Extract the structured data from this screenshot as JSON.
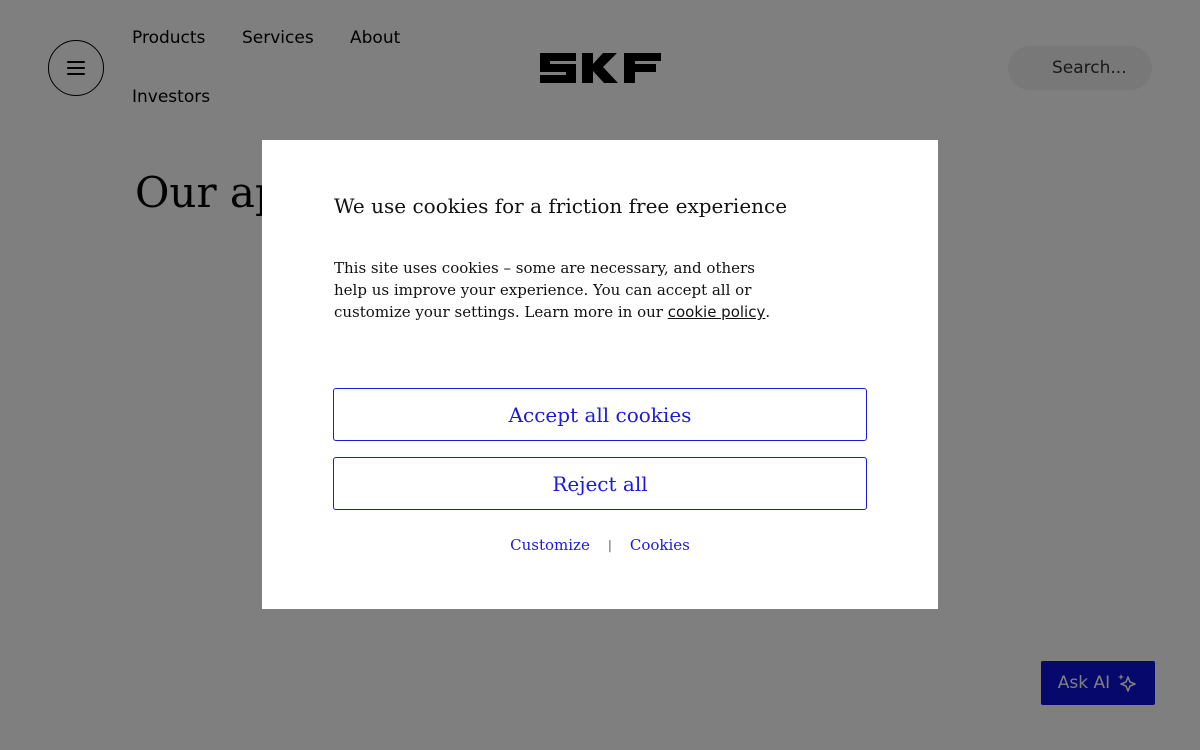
{
  "header": {
    "menu_icon": "hamburger-icon",
    "nav": {
      "products": "Products",
      "services": "Services",
      "about": "About",
      "investors": "Investors"
    },
    "logo_text": "SKF",
    "search": {
      "placeholder": "Search...",
      "icon": "search-icon"
    }
  },
  "page": {
    "heading": "Our ap"
  },
  "cookie_modal": {
    "title": "We use cookies for a friction free experience",
    "body_prefix": "This site uses cookies – some are necessary, and others help us improve your experience. You can accept all or customize your settings. Learn more in our ",
    "policy_link": "cookie policy",
    "body_suffix": ".",
    "accept_label": "Accept all cookies",
    "reject_label": "Reject all",
    "customize_label": "Customize",
    "separator": "|",
    "cookies_label": "Cookies"
  },
  "ask_ai": {
    "label": "Ask AI",
    "icon": "sparkle-icon"
  },
  "colors": {
    "accent": "#1a1adb",
    "ask_ai_bg": "#0f10d8",
    "overlay": "rgba(0,0,0,0.5)"
  }
}
